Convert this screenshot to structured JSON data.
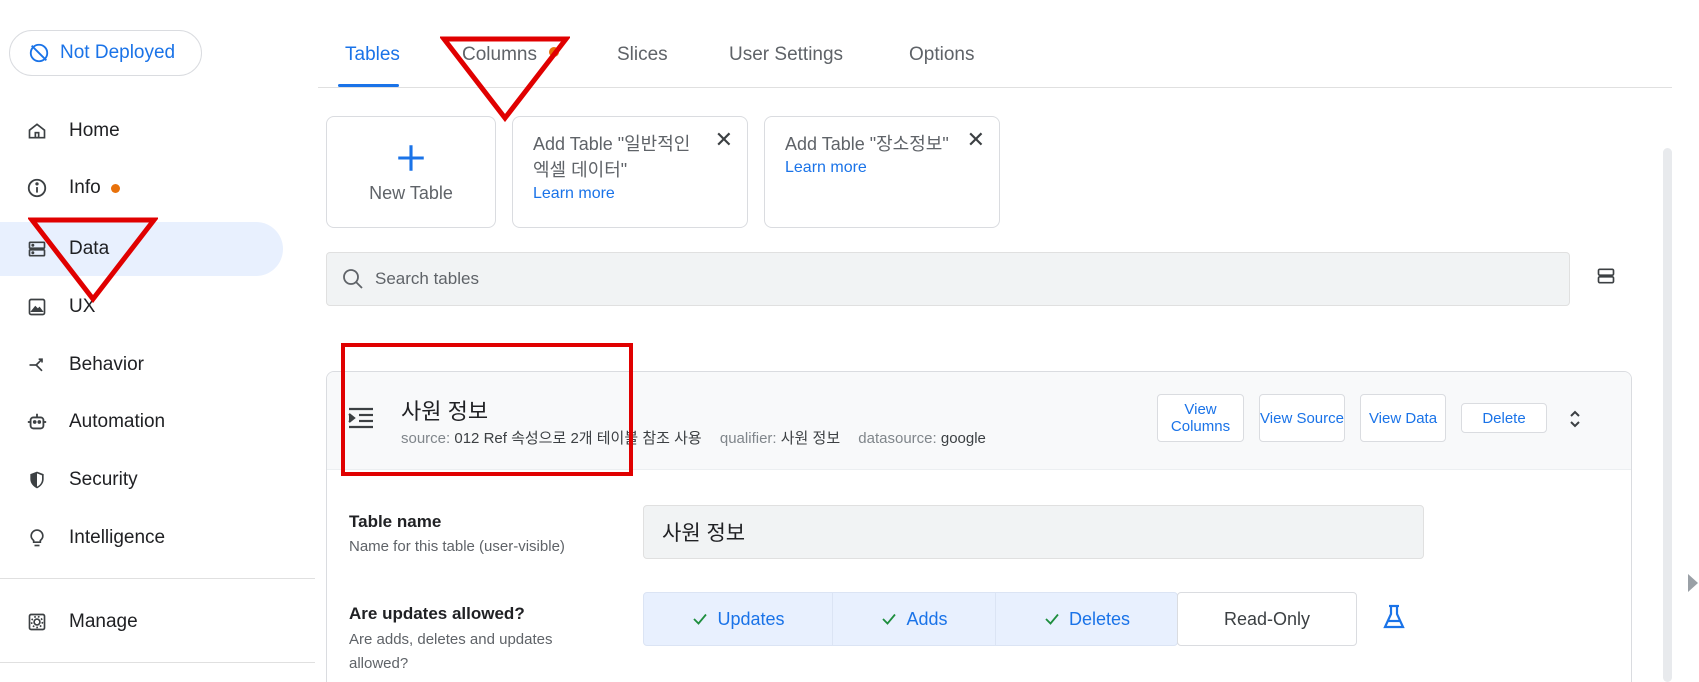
{
  "deploy": {
    "label": "Not Deployed"
  },
  "sidebar": {
    "items": [
      {
        "label": "Home",
        "icon": "home-icon"
      },
      {
        "label": "Info",
        "icon": "info-icon"
      },
      {
        "label": "Data",
        "icon": "data-icon"
      },
      {
        "label": "UX",
        "icon": "image-icon"
      },
      {
        "label": "Behavior",
        "icon": "branch-icon"
      },
      {
        "label": "Automation",
        "icon": "robot-icon"
      },
      {
        "label": "Security",
        "icon": "shield-icon"
      },
      {
        "label": "Intelligence",
        "icon": "lightbulb-icon"
      },
      {
        "label": "Manage",
        "icon": "gear-box-icon"
      }
    ]
  },
  "tabs": [
    "Tables",
    "Columns",
    "Slices",
    "User Settings",
    "Options"
  ],
  "cards": {
    "new_table": "New Table",
    "add_tables": [
      {
        "title": "Add Table \"일반적인 엑셀 데이터\"",
        "link": "Learn more"
      },
      {
        "title": "Add Table \"장소정보\"",
        "link": "Learn more"
      }
    ],
    "close_glyph": "✕"
  },
  "search": {
    "placeholder": "Search tables"
  },
  "table": {
    "name": "사원 정보",
    "source_label": "source:",
    "source_value": "012 Ref 속성으로 2개 테이블 참조 사용",
    "qualifier_label": "qualifier:",
    "qualifier_value": "사원 정보",
    "datasource_label": "datasource:",
    "datasource_value": "google",
    "buttons": {
      "view_columns": "View Columns",
      "view_source": "View Source",
      "view_data": "View Data",
      "delete": "Delete"
    },
    "fields": {
      "name_label": "Table name",
      "name_help": "Name for this table (user-visible)",
      "name_value": "사원 정보",
      "updates_label": "Are updates allowed?",
      "updates_help": "Are adds, deletes and updates allowed?",
      "updates_options": [
        "Updates",
        "Adds",
        "Deletes"
      ],
      "read_only": "Read-Only"
    }
  },
  "colors": {
    "accent": "#1a73e8",
    "badge": "#e8710a",
    "annotation": "#e00000"
  }
}
